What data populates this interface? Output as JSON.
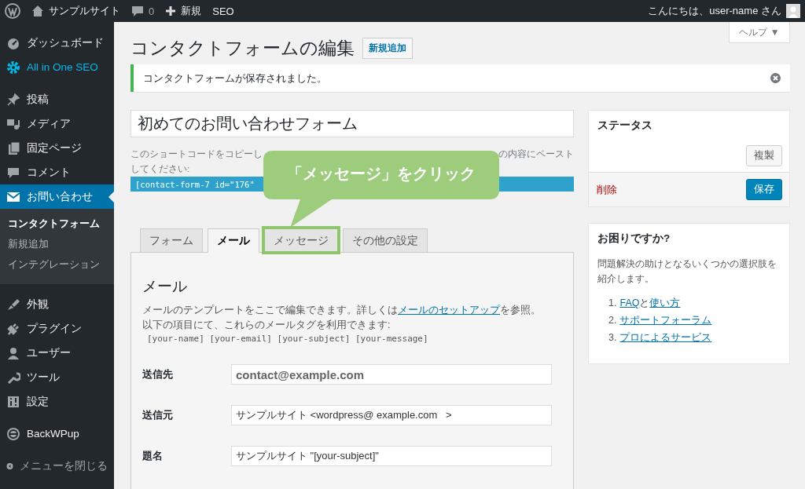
{
  "admin_bar": {
    "site_name": "サンプルサイト",
    "comments": "0",
    "new_label": "新規",
    "seo_label": "SEO",
    "greeting": "こんにちは、user-name さん"
  },
  "sidebar": {
    "groups": [
      {
        "items": [
          {
            "label": "ダッシュボード",
            "selected": false
          },
          {
            "label": "All in One SEO",
            "selected": false
          }
        ]
      },
      {
        "items": [
          {
            "label": "投稿",
            "selected": false
          },
          {
            "label": "メディア",
            "selected": false
          },
          {
            "label": "固定ページ",
            "selected": false
          },
          {
            "label": "コメント",
            "selected": false
          },
          {
            "label": "お問い合わせ",
            "selected": true,
            "children": [
              {
                "label": "コンタクトフォーム",
                "selected": true
              },
              {
                "label": "新規追加",
                "selected": false
              },
              {
                "label": "インテグレーション",
                "selected": false
              }
            ]
          }
        ]
      },
      {
        "items": [
          {
            "label": "外観",
            "selected": false
          },
          {
            "label": "プラグイン",
            "selected": false
          },
          {
            "label": "ユーザー",
            "selected": false
          },
          {
            "label": "ツール",
            "selected": false
          },
          {
            "label": "設定",
            "selected": false
          }
        ]
      },
      {
        "items": [
          {
            "label": "BackWPup",
            "selected": false
          }
        ]
      }
    ],
    "collapse": "メニューを閉じる"
  },
  "help_tab": "ヘルプ ▼",
  "page_title": "コンタクトフォームの編集",
  "add_new": "新規追加",
  "notice": "コンタクトフォームが保存されました。",
  "form_title": "初めてのお問い合わせフォーム",
  "shortcode": {
    "description_left": "このショートコードをコピーし",
    "description_right": "の内容にペースト",
    "description_line2": "してください:",
    "code": "[contact-form-7 id=\"176\""
  },
  "callout": {
    "text": "「メッセージ」をクリック"
  },
  "tabs": [
    {
      "label": "フォーム",
      "selected": false,
      "highlighted": false
    },
    {
      "label": "メール",
      "selected": true,
      "highlighted": false
    },
    {
      "label": "メッセージ",
      "selected": false,
      "highlighted": true
    },
    {
      "label": "その他の設定",
      "selected": false,
      "highlighted": false
    }
  ],
  "mail_panel": {
    "heading": "メール",
    "description_before": "メールのテンプレートをここで編集できます。詳しくは",
    "description_link": "メールのセットアップ",
    "description_after": "を参照。",
    "tags_intro": "以下の項目にて、これらのメールタグを利用できます:",
    "tags": "[your-name] [your-email] [your-subject] [your-message]",
    "fields": [
      {
        "label": "送信先",
        "value": "contact@example.com"
      },
      {
        "label": "送信元",
        "value": "サンプルサイト <wordpress@ example.com   >"
      },
      {
        "label": "題名",
        "value": "サンプルサイト \"[your-subject]\""
      }
    ]
  },
  "status_box": {
    "title": "ステータス",
    "duplicate": "複製",
    "delete": "削除",
    "save": "保存"
  },
  "help_box": {
    "title": "お困りですか?",
    "text": "問題解決の助けとなるいくつかの選択肢を紹介します。",
    "links": [
      {
        "number": "1.",
        "parts": [
          "FAQ",
          "と",
          "使い方"
        ]
      },
      {
        "number": "2.",
        "parts": [
          "サポートフォーラム"
        ]
      },
      {
        "number": "3.",
        "parts": [
          "プロによるサービス"
        ]
      }
    ]
  }
}
